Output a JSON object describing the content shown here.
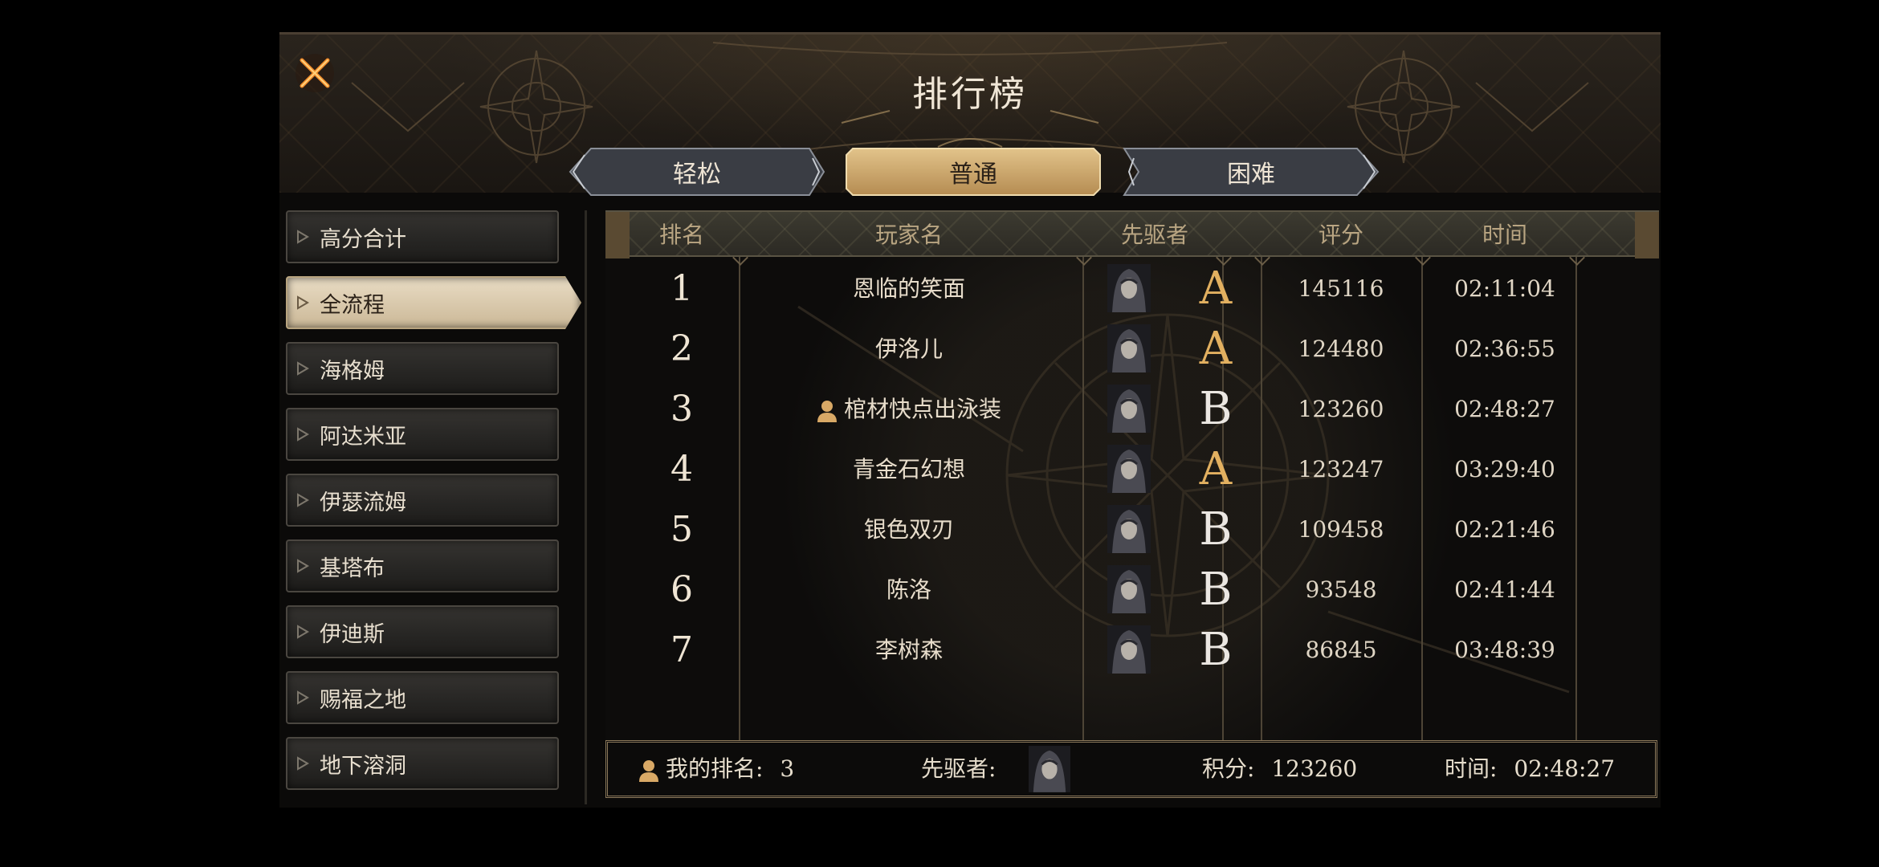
{
  "window": {
    "title": "排行榜"
  },
  "tabs": [
    {
      "label": "轻松",
      "active": false
    },
    {
      "label": "普通",
      "active": true
    },
    {
      "label": "困难",
      "active": false
    }
  ],
  "sidebar": {
    "items": [
      {
        "label": "高分合计",
        "active": false
      },
      {
        "label": "全流程",
        "active": true
      },
      {
        "label": "海格姆",
        "active": false
      },
      {
        "label": "阿达米亚",
        "active": false
      },
      {
        "label": "伊瑟流姆",
        "active": false
      },
      {
        "label": "基塔布",
        "active": false
      },
      {
        "label": "伊迪斯",
        "active": false
      },
      {
        "label": "赐福之地",
        "active": false
      },
      {
        "label": "地下溶洞",
        "active": false
      }
    ]
  },
  "table": {
    "headers": {
      "rank": "排名",
      "player": "玩家名",
      "pioneer": "先驱者",
      "score": "评分",
      "time": "时间"
    },
    "rows": [
      {
        "rank": "1",
        "name": "恩临的笑面",
        "is_self": false,
        "grade": "A",
        "score": "145116",
        "time": "02:11:04"
      },
      {
        "rank": "2",
        "name": "伊洛儿",
        "is_self": false,
        "grade": "A",
        "score": "124480",
        "time": "02:36:55"
      },
      {
        "rank": "3",
        "name": "棺材快点出泳装",
        "is_self": true,
        "grade": "B",
        "score": "123260",
        "time": "02:48:27"
      },
      {
        "rank": "4",
        "name": "青金石幻想",
        "is_self": false,
        "grade": "A",
        "score": "123247",
        "time": "03:29:40"
      },
      {
        "rank": "5",
        "name": "银色双刃",
        "is_self": false,
        "grade": "B",
        "score": "109458",
        "time": "02:21:46"
      },
      {
        "rank": "6",
        "name": "陈洛",
        "is_self": false,
        "grade": "B",
        "score": "93548",
        "time": "02:41:44"
      },
      {
        "rank": "7",
        "name": "李树森",
        "is_self": false,
        "grade": "B",
        "score": "86845",
        "time": "03:48:39"
      }
    ]
  },
  "footer": {
    "my_rank_label": "我的排名:",
    "my_rank_value": "3",
    "pioneer_label": "先驱者:",
    "score_label": "积分:",
    "score_value": "123260",
    "time_label": "时间:",
    "time_value": "02:48:27"
  },
  "colors": {
    "grade_a": "#e2b060",
    "grade_b": "#ebe7e2",
    "tab_active": "#c9a468",
    "tab_inactive": "#3c3f45",
    "sidebar_active": "#e0d0b2"
  },
  "icons": {
    "close": "close-x-icon",
    "player": "user-icon",
    "pioneer": "hooded-avatar-icon",
    "sidebar_arrow": "arrow-right-icon"
  }
}
